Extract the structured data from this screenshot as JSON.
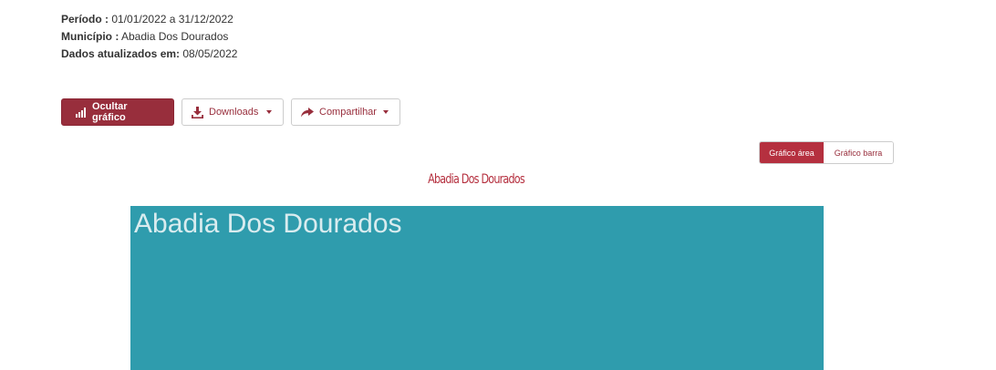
{
  "info": {
    "periodo_label": "Período :",
    "periodo_value": "01/01/2022 a 31/12/2022",
    "municipio_label": "Município :",
    "municipio_value": "Abadia Dos Dourados",
    "atualizados_label": "Dados atualizados em:",
    "atualizados_value": "08/05/2022"
  },
  "toolbar": {
    "hide_chart_label": "Ocultar gráfico",
    "downloads_label": "Downloads",
    "share_label": "Compartilhar"
  },
  "chart_toggle": {
    "area_label": "Gráfico área",
    "bar_label": "Gráfico barra",
    "active": "area"
  },
  "chart": {
    "title": "Abadia Dos Dourados",
    "area_label": "Abadia Dos Dourados"
  },
  "colors": {
    "brand": "#982e3c",
    "chart_fill": "#2f9cad"
  },
  "icons": {
    "hide_chart": "bar-chart-icon",
    "downloads": "download-icon",
    "share": "share-icon"
  }
}
